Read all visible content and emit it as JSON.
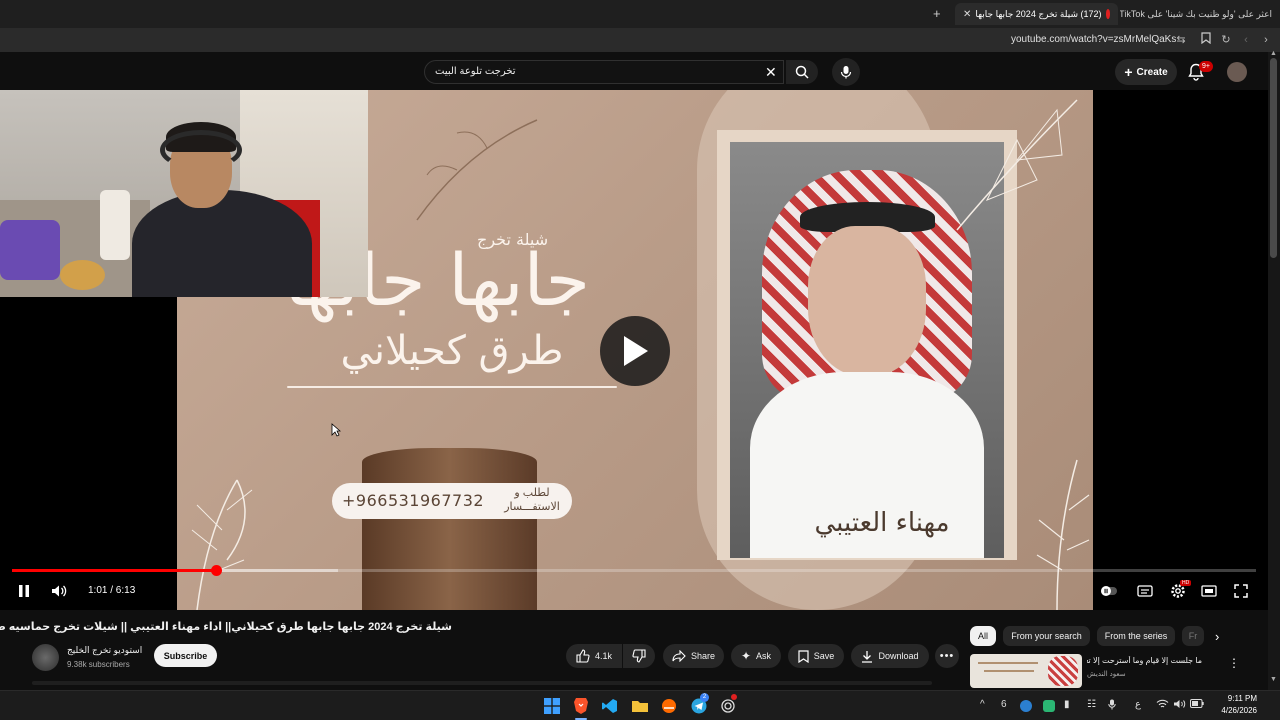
{
  "browser": {
    "tabs": [
      {
        "title": "اعثر على 'ولو ظنيت بك شينا' على TikTok",
        "active": false
      },
      {
        "title": "(172) شيلة تخرج 2024 جابها جابها",
        "active": true
      }
    ],
    "new_tab": "+",
    "url": "youtube.com/watch?v=zsMrMelQaKs"
  },
  "header": {
    "search_value": "تخرجت تلوعة البيت",
    "create_label": "Create",
    "notifications_badge": "9+"
  },
  "video": {
    "overlay_small": "شيلة تخرج",
    "overlay_big": "جابها جابها",
    "overlay_mid": "طرق كحيلاني",
    "phone": "+966531967732",
    "phone_note": "لطلب و الاستفـــسار",
    "singer_name": "مهناء العتيبي",
    "time_current": "1:01",
    "time_total": "6:13",
    "time_display": "1:01 / 6:13",
    "progress_fraction": 0.164,
    "buffered_fraction": 0.262
  },
  "details": {
    "title": "شيلة تخرج 2024 جابها جابها طرق كحيلاني|| اداء مهناء العتيبي || شيلات تخرج حماسيه طرب",
    "channel_name": "استوديو تخرج الخليج",
    "subscribers": "9.38k subscribers",
    "subscribe_label": "Subscribe",
    "likes": "4.1k",
    "share_label": "Share",
    "ask_label": "Ask",
    "save_label": "Save",
    "download_label": "Download"
  },
  "chips": [
    "All",
    "From your search",
    "From the series",
    "Fr"
  ],
  "recommendation": {
    "title": "ما جلست إلا قيام وما أسترحت إلا تعب",
    "channel": "سعود النديش"
  },
  "taskbar": {
    "time": "9:11 PM",
    "date": "4/26/2026",
    "tray_lang": "ع",
    "tray_num": "6"
  },
  "colors": {
    "progress": "#ff0000",
    "background": "#0f0f0f"
  }
}
